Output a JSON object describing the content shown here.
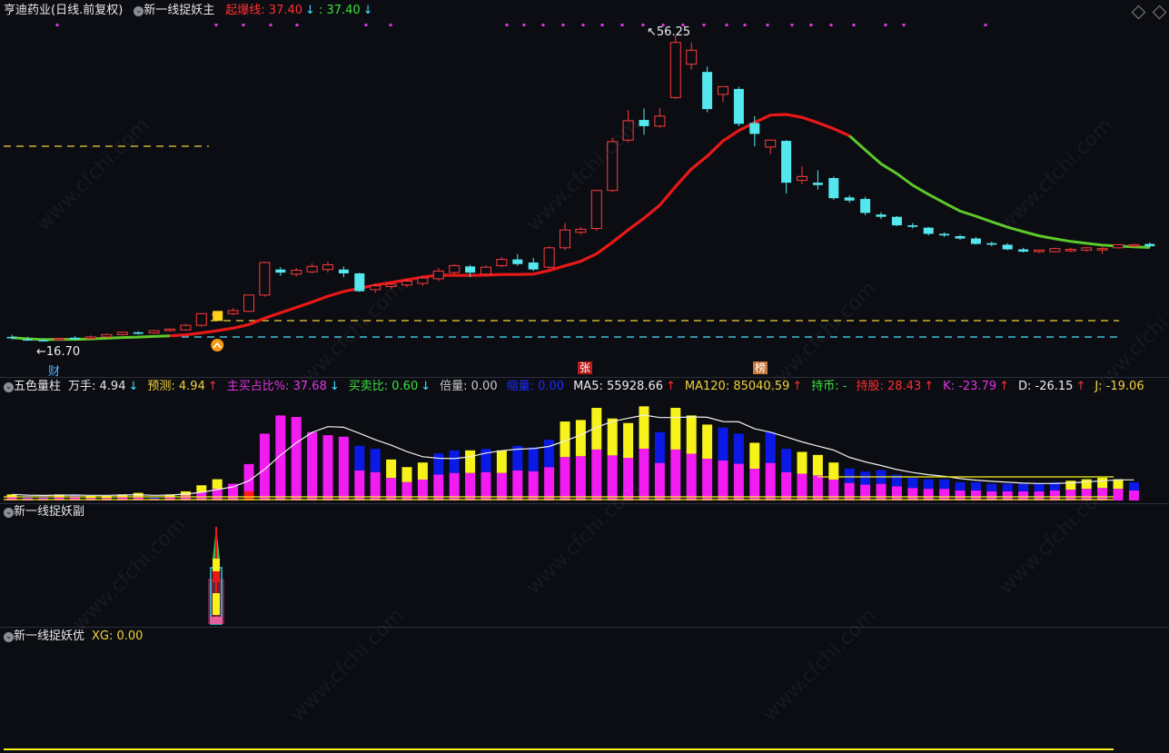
{
  "main_panel": {
    "title": "亨迪药业(日线.前复权)",
    "indicator_name": "新一线捉妖主",
    "qibao_label": "起爆线: 37.40",
    "qibao_arrow": "↓",
    "value2_label": ": 37.40",
    "value2_arrow": "↓",
    "high_label": "56.25",
    "low_label": "16.70",
    "marker_cai": "财",
    "marker_zhang": "张",
    "marker_bang": "榜",
    "colors": {
      "up": "#ff3b3b",
      "down": "#54e8ee",
      "ma_red": "#e81818",
      "ma_green": "#5ec829",
      "dash_yellow": "#f4d23a",
      "dash_cyan": "#4fe2ff",
      "dot_magenta": "#e233e2"
    }
  },
  "volume_panel": {
    "name": "五色量柱",
    "wanshou": "万手: 4.94",
    "wanshou_arrow": "↓",
    "yuce": "预测: 4.94",
    "yuce_arrow": "↑",
    "zhumai": "主买占比%: 37.68",
    "zhumai_arrow": "↓",
    "maimai": "买卖比: 0.60",
    "maimai_arrow": "↓",
    "beiliang": "倍量: 0.00",
    "jianliang": "缩量: 0.00",
    "ma5": "MA5: 55928.66",
    "ma5_arrow": "↑",
    "ma120": "MA120: 85040.59",
    "ma120_arrow": "↑",
    "chibi": "持币: -",
    "chigu": "持股: 28.43",
    "chigu_arrow": "↑",
    "k": "K: -23.79",
    "k_arrow": "↑",
    "d": "D: -26.15",
    "d_arrow": "↑",
    "j": "J: -19.06"
  },
  "sub_panel": {
    "name": "新一线捉妖副"
  },
  "opt_panel": {
    "name": "新一线捉妖优",
    "xg": "XG: 0.00"
  },
  "watermark": "www.cfchi.com",
  "icons": {
    "panel_toggle": "chevron-circle-icon",
    "top_right": "diamond-icon"
  },
  "chart_data": {
    "type": "candlestick",
    "candles": [
      {
        "o": 17.3,
        "h": 17.6,
        "c": 17.2,
        "l": 17.0
      },
      {
        "o": 17.0,
        "h": 17.3,
        "c": 16.9,
        "l": 16.8
      },
      {
        "o": 16.9,
        "h": 17.1,
        "c": 16.75,
        "l": 16.7
      },
      {
        "o": 17.0,
        "h": 17.2,
        "c": 17.1,
        "l": 16.9
      },
      {
        "o": 17.2,
        "h": 17.4,
        "c": 17.0,
        "l": 16.9
      },
      {
        "o": 17.1,
        "h": 17.5,
        "c": 17.3,
        "l": 17.0
      },
      {
        "o": 17.3,
        "h": 17.7,
        "c": 17.6,
        "l": 17.2
      },
      {
        "o": 17.6,
        "h": 18.0,
        "c": 17.9,
        "l": 17.5
      },
      {
        "o": 17.9,
        "h": 18.0,
        "c": 17.7,
        "l": 17.6
      },
      {
        "o": 17.8,
        "h": 18.2,
        "c": 18.1,
        "l": 17.7
      },
      {
        "o": 18.1,
        "h": 18.4,
        "c": 18.3,
        "l": 18.0
      },
      {
        "o": 18.2,
        "h": 19.0,
        "c": 18.8,
        "l": 18.1
      },
      {
        "o": 18.8,
        "h": 20.3,
        "c": 20.3,
        "l": 18.6
      },
      {
        "o": 20.2,
        "h": 20.6,
        "c": 20.3,
        "l": 19.9
      },
      {
        "o": 20.3,
        "h": 21.0,
        "c": 20.7,
        "l": 20.1
      },
      {
        "o": 20.6,
        "h": 22.7,
        "c": 22.7,
        "l": 20.5
      },
      {
        "o": 22.7,
        "h": 27.0,
        "c": 26.9,
        "l": 22.5
      },
      {
        "o": 26.0,
        "h": 26.3,
        "c": 25.6,
        "l": 25.2
      },
      {
        "o": 25.4,
        "h": 26.2,
        "c": 25.9,
        "l": 25.1
      },
      {
        "o": 25.7,
        "h": 26.8,
        "c": 26.4,
        "l": 25.5
      },
      {
        "o": 26.0,
        "h": 27.0,
        "c": 26.6,
        "l": 25.6
      },
      {
        "o": 26.0,
        "h": 26.4,
        "c": 25.5,
        "l": 25.0
      },
      {
        "o": 25.5,
        "h": 25.6,
        "c": 23.2,
        "l": 23.1
      },
      {
        "o": 23.4,
        "h": 24.2,
        "c": 23.9,
        "l": 23.0
      },
      {
        "o": 23.8,
        "h": 24.3,
        "c": 24.1,
        "l": 23.5
      },
      {
        "o": 24.0,
        "h": 24.8,
        "c": 24.5,
        "l": 23.7
      },
      {
        "o": 24.2,
        "h": 25.2,
        "c": 24.9,
        "l": 23.9
      },
      {
        "o": 24.8,
        "h": 26.2,
        "c": 25.8,
        "l": 24.5
      },
      {
        "o": 25.6,
        "h": 26.7,
        "c": 26.5,
        "l": 25.4
      },
      {
        "o": 26.4,
        "h": 26.6,
        "c": 25.6,
        "l": 25.0
      },
      {
        "o": 25.4,
        "h": 26.5,
        "c": 26.3,
        "l": 25.2
      },
      {
        "o": 26.5,
        "h": 27.6,
        "c": 27.3,
        "l": 26.3
      },
      {
        "o": 27.3,
        "h": 28.0,
        "c": 26.7,
        "l": 26.5
      },
      {
        "o": 26.9,
        "h": 27.5,
        "c": 26.0,
        "l": 25.8
      },
      {
        "o": 26.3,
        "h": 29.0,
        "c": 28.8,
        "l": 26.1
      },
      {
        "o": 28.8,
        "h": 32.0,
        "c": 31.1,
        "l": 28.5
      },
      {
        "o": 30.8,
        "h": 31.5,
        "c": 31.2,
        "l": 30.5
      },
      {
        "o": 31.3,
        "h": 36.3,
        "c": 36.2,
        "l": 31.0
      },
      {
        "o": 36.2,
        "h": 43.0,
        "c": 42.5,
        "l": 36.0
      },
      {
        "o": 42.7,
        "h": 46.6,
        "c": 45.2,
        "l": 42.4
      },
      {
        "o": 45.3,
        "h": 46.8,
        "c": 44.5,
        "l": 43.4
      },
      {
        "o": 44.5,
        "h": 46.8,
        "c": 45.8,
        "l": 44.3
      },
      {
        "o": 48.2,
        "h": 56.25,
        "c": 55.3,
        "l": 48.0
      },
      {
        "o": 52.5,
        "h": 55.3,
        "c": 54.3,
        "l": 51.8
      },
      {
        "o": 51.5,
        "h": 52.2,
        "c": 46.7,
        "l": 46.3
      },
      {
        "o": 48.6,
        "h": 49.0,
        "c": 49.6,
        "l": 47.6
      },
      {
        "o": 49.3,
        "h": 49.6,
        "c": 44.8,
        "l": 44.5
      },
      {
        "o": 44.9,
        "h": 45.8,
        "c": 43.5,
        "l": 41.9
      },
      {
        "o": 41.8,
        "h": 42.0,
        "c": 42.7,
        "l": 40.9
      },
      {
        "o": 42.6,
        "h": 42.7,
        "c": 37.2,
        "l": 35.8
      },
      {
        "o": 37.5,
        "h": 39.3,
        "c": 38.0,
        "l": 37.0
      },
      {
        "o": 37.2,
        "h": 38.8,
        "c": 36.9,
        "l": 36.3
      },
      {
        "o": 37.8,
        "h": 38.0,
        "c": 35.2,
        "l": 35.0
      },
      {
        "o": 35.3,
        "h": 35.6,
        "c": 34.9,
        "l": 34.6
      },
      {
        "o": 35.1,
        "h": 35.4,
        "c": 33.3,
        "l": 33.0
      },
      {
        "o": 33.1,
        "h": 33.4,
        "c": 32.8,
        "l": 32.5
      },
      {
        "o": 32.8,
        "h": 32.9,
        "c": 31.7,
        "l": 31.6
      },
      {
        "o": 31.7,
        "h": 32.0,
        "c": 31.5,
        "l": 31.3
      },
      {
        "o": 31.4,
        "h": 31.5,
        "c": 30.6,
        "l": 30.4
      },
      {
        "o": 30.6,
        "h": 30.8,
        "c": 30.4,
        "l": 30.2
      },
      {
        "o": 30.3,
        "h": 30.5,
        "c": 30.0,
        "l": 29.8
      },
      {
        "o": 30.0,
        "h": 30.2,
        "c": 29.3,
        "l": 29.2
      },
      {
        "o": 29.4,
        "h": 29.6,
        "c": 29.2,
        "l": 29.0
      },
      {
        "o": 29.2,
        "h": 29.4,
        "c": 28.6,
        "l": 28.5
      },
      {
        "o": 28.6,
        "h": 28.8,
        "c": 28.3,
        "l": 28.2
      },
      {
        "o": 28.3,
        "h": 28.5,
        "c": 28.5,
        "l": 28.1
      },
      {
        "o": 28.3,
        "h": 28.8,
        "c": 28.7,
        "l": 28.2
      },
      {
        "o": 28.4,
        "h": 28.8,
        "c": 28.6,
        "l": 28.2
      },
      {
        "o": 28.5,
        "h": 28.9,
        "c": 28.8,
        "l": 28.3
      },
      {
        "o": 28.6,
        "h": 28.9,
        "c": 28.7,
        "l": 28.0
      },
      {
        "o": 28.8,
        "h": 29.3,
        "c": 29.2,
        "l": 28.7
      },
      {
        "o": 29.1,
        "h": 29.3,
        "c": 29.2,
        "l": 28.9
      },
      {
        "o": 29.3,
        "h": 29.5,
        "c": 29.0,
        "l": 28.8
      }
    ],
    "ylim": [
      16.0,
      57.5
    ],
    "high_value": 56.25,
    "low_value": 16.7,
    "qibao_level": 37.4,
    "volume": {
      "total": [
        4,
        3,
        3,
        4,
        4,
        3,
        3,
        4,
        5,
        2,
        4,
        6,
        10,
        14,
        11,
        24,
        44,
        56,
        55,
        45,
        43,
        42,
        36,
        34,
        27,
        22,
        25,
        31,
        33,
        33,
        34,
        33,
        36,
        35,
        40,
        52,
        53,
        61,
        54,
        51,
        62,
        45,
        61,
        56,
        50,
        48,
        44,
        38,
        45,
        34,
        32,
        30,
        25,
        21,
        19,
        20,
        17,
        15,
        14,
        14,
        12,
        12,
        11,
        11,
        11,
        11,
        12,
        13,
        14,
        15,
        14,
        12
      ],
      "colors": [
        "y",
        "b",
        "b",
        "y",
        "b",
        "y",
        "y",
        "y",
        "y",
        "b",
        "y",
        "y",
        "y",
        "y",
        "m",
        "m",
        "m",
        "m",
        "m",
        "m",
        "m",
        "m",
        "b",
        "b",
        "y",
        "y",
        "y",
        "b",
        "b",
        "y",
        "b",
        "y",
        "b",
        "b",
        "b",
        "y",
        "y",
        "y",
        "y",
        "y",
        "y",
        "b",
        "y",
        "y",
        "y",
        "b",
        "b",
        "y",
        "b",
        "b",
        "y",
        "y",
        "y",
        "b",
        "b",
        "b",
        "b",
        "b",
        "b",
        "b",
        "b",
        "b",
        "b",
        "b",
        "b",
        "b",
        "b",
        "y",
        "y",
        "y",
        "y",
        "b"
      ]
    }
  }
}
